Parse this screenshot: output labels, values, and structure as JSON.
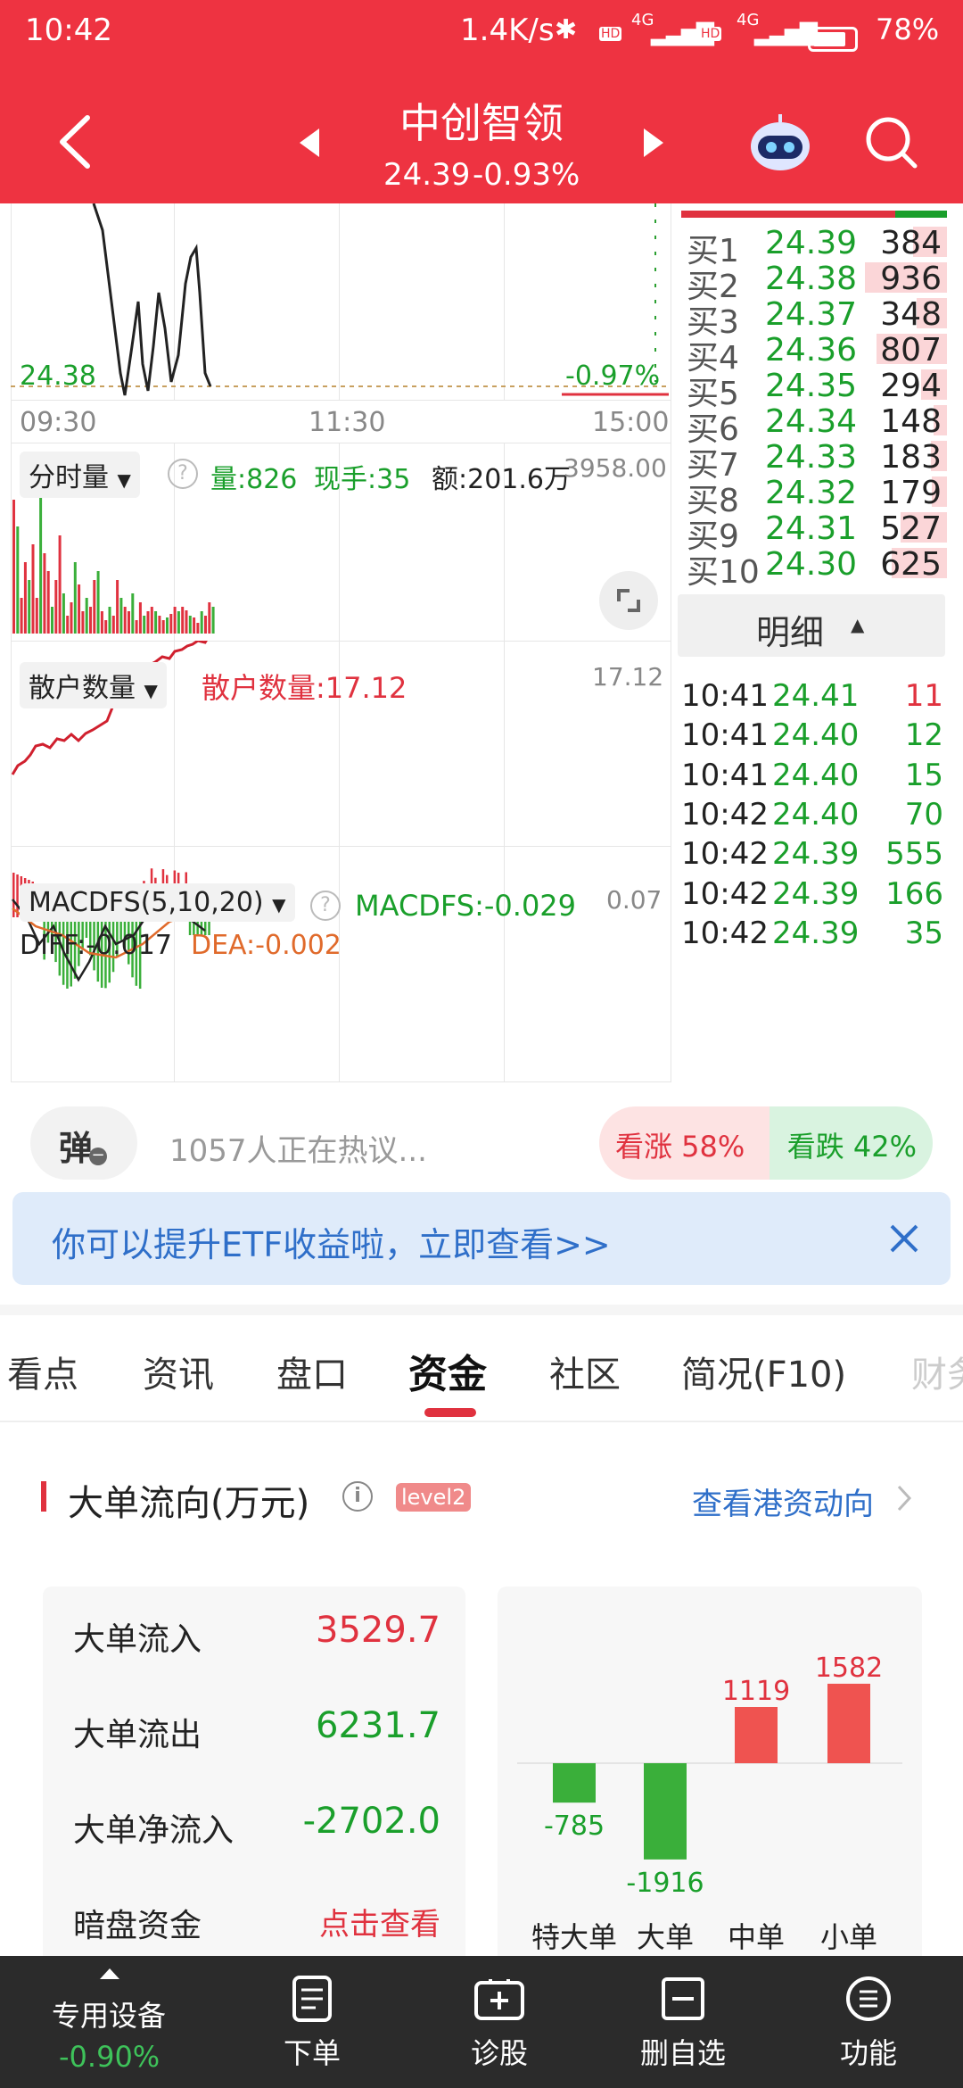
{
  "status_bar": {
    "time": "10:42",
    "net_speed": "1.4K/s",
    "signal_1": "4G",
    "signal_2": "4G",
    "battery": "78%"
  },
  "header": {
    "title": "中创智领",
    "price": "24.39",
    "change": "-0.93%"
  },
  "chart": {
    "price_left": "24.38",
    "pct_right": "-0.97%",
    "time_ticks": [
      "09:30",
      "11:30",
      "15:00"
    ],
    "volume": {
      "selector": "分时量",
      "vol": "量:826",
      "hand": "现手:35",
      "amount": "额:201.6万",
      "max": "3958.00"
    },
    "retail": {
      "selector": "散户数量",
      "value": "散户数量:17.12",
      "max": "17.12"
    },
    "macd": {
      "selector": "MACDFS(5,10,20)",
      "macdfs": "MACDFS:-0.029",
      "max": "0.07",
      "diff": "DIFF:-0.017",
      "dea": "DEA:-0.002"
    }
  },
  "order_book": [
    {
      "label": "买1",
      "price": "24.39",
      "qty": "384",
      "fill": 0.41
    },
    {
      "label": "买2",
      "price": "24.38",
      "qty": "936",
      "fill": 1.0
    },
    {
      "label": "买3",
      "price": "24.37",
      "qty": "348",
      "fill": 0.37
    },
    {
      "label": "买4",
      "price": "24.36",
      "qty": "807",
      "fill": 0.86
    },
    {
      "label": "买5",
      "price": "24.35",
      "qty": "294",
      "fill": 0.31
    },
    {
      "label": "买6",
      "price": "24.34",
      "qty": "148",
      "fill": 0.16
    },
    {
      "label": "买7",
      "price": "24.33",
      "qty": "183",
      "fill": 0.2
    },
    {
      "label": "买8",
      "price": "24.32",
      "qty": "179",
      "fill": 0.19
    },
    {
      "label": "买9",
      "price": "24.31",
      "qty": "527",
      "fill": 0.56
    },
    {
      "label": "买10",
      "price": "24.30",
      "qty": "625",
      "fill": 0.67
    }
  ],
  "detail_label": "明细",
  "ticks": [
    {
      "time": "10:41",
      "price": "24.41",
      "qty": "11",
      "dir": "up"
    },
    {
      "time": "10:41",
      "price": "24.40",
      "qty": "12",
      "dir": "down"
    },
    {
      "time": "10:41",
      "price": "24.40",
      "qty": "15",
      "dir": "down"
    },
    {
      "time": "10:42",
      "price": "24.40",
      "qty": "70",
      "dir": "down"
    },
    {
      "time": "10:42",
      "price": "24.39",
      "qty": "555",
      "dir": "down"
    },
    {
      "time": "10:42",
      "price": "24.39",
      "qty": "166",
      "dir": "down"
    },
    {
      "time": "10:42",
      "price": "24.39",
      "qty": "35",
      "dir": "down"
    }
  ],
  "discussion": {
    "bubble": "弹",
    "text": "1057人正在热议...",
    "bull": "看涨 58%",
    "bear": "看跌 42%",
    "bull_ratio": 0.58
  },
  "banner": {
    "text": "你可以提升ETF收益啦，立即查看>>"
  },
  "tabs": [
    "看点",
    "资讯",
    "盘口",
    "资金",
    "社区",
    "简况(F10)",
    "财务"
  ],
  "active_tab": "资金",
  "flow": {
    "title": "大单流向(万元)",
    "badge": "level2",
    "link": "查看港资动向",
    "stats": [
      {
        "label": "大单流入",
        "value": "3529.7",
        "color": "#e0323f"
      },
      {
        "label": "大单流出",
        "value": "6231.7",
        "color": "#1a9f2b"
      },
      {
        "label": "大单净流入",
        "value": "-2702.0",
        "color": "#1a9f2b"
      },
      {
        "label": "暗盘资金",
        "value": "点击查看",
        "color": "#e0323f"
      }
    ]
  },
  "chart_data": {
    "type": "bar",
    "categories": [
      "特大单",
      "大单",
      "中单",
      "小单"
    ],
    "values": [
      -785,
      -1916,
      1119,
      1582
    ],
    "colors": [
      "#3aaf3a",
      "#3aaf3a",
      "#ef5350",
      "#ef5350"
    ]
  },
  "bottom_nav": {
    "device_label": "专用设备",
    "device_change": "-0.90%",
    "items": [
      "下单",
      "诊股",
      "删自选",
      "功能"
    ]
  }
}
